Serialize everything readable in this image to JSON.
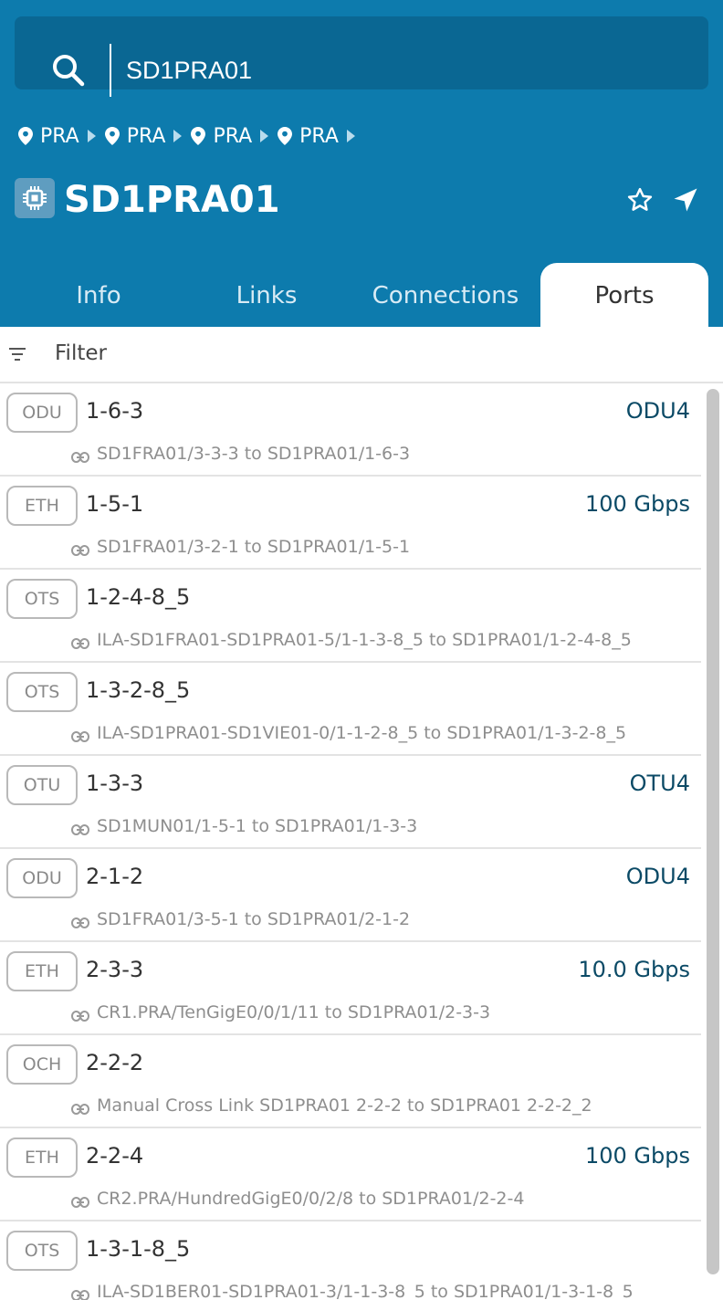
{
  "search": {
    "value": "SD1PRA01"
  },
  "breadcrumb": [
    {
      "label": "PRA"
    },
    {
      "label": "PRA"
    },
    {
      "label": "PRA"
    },
    {
      "label": "PRA"
    }
  ],
  "header": {
    "title": "SD1PRA01"
  },
  "tabs": [
    {
      "label": "Info"
    },
    {
      "label": "Links"
    },
    {
      "label": "Connections"
    },
    {
      "label": "Ports",
      "active": true
    }
  ],
  "filter": {
    "label": "Filter"
  },
  "ports": [
    {
      "type": "ODU",
      "name": "1-6-3",
      "rate": "ODU4",
      "link": "SD1FRA01/3-3-3 to SD1PRA01/1-6-3"
    },
    {
      "type": "ETH",
      "name": "1-5-1",
      "rate": "100 Gbps",
      "link": "SD1FRA01/3-2-1 to SD1PRA01/1-5-1"
    },
    {
      "type": "OTS",
      "name": "1-2-4-8_5",
      "rate": "",
      "link": "ILA-SD1FRA01-SD1PRA01-5/1-1-3-8_5 to SD1PRA01/1-2-4-8_5"
    },
    {
      "type": "OTS",
      "name": "1-3-2-8_5",
      "rate": "",
      "link": "ILA-SD1PRA01-SD1VIE01-0/1-1-2-8_5 to SD1PRA01/1-3-2-8_5"
    },
    {
      "type": "OTU",
      "name": "1-3-3",
      "rate": "OTU4",
      "link": "SD1MUN01/1-5-1 to SD1PRA01/1-3-3"
    },
    {
      "type": "ODU",
      "name": "2-1-2",
      "rate": "ODU4",
      "link": "SD1FRA01/3-5-1 to SD1PRA01/2-1-2"
    },
    {
      "type": "ETH",
      "name": "2-3-3",
      "rate": "10.0 Gbps",
      "link": "CR1.PRA/TenGigE0/0/1/11 to SD1PRA01/2-3-3"
    },
    {
      "type": "OCH",
      "name": "2-2-2",
      "rate": "",
      "link": "Manual Cross Link SD1PRA01 2-2-2 to SD1PRA01 2-2-2_2"
    },
    {
      "type": "ETH",
      "name": "2-2-4",
      "rate": "100 Gbps",
      "link": "CR2.PRA/HundredGigE0/0/2/8 to SD1PRA01/2-2-4"
    },
    {
      "type": "OTS",
      "name": "1-3-1-8_5",
      "rate": "",
      "link": "ILA-SD1BER01-SD1PRA01-3/1-1-3-8_5 to SD1PRA01/1-3-1-8_5"
    }
  ],
  "colors": {
    "header_bg": "#0d7bad",
    "search_bg": "#0a6793",
    "rate_text": "#0b4a66"
  },
  "icons": [
    "search-icon",
    "location-pin-icon",
    "chevron-right-icon",
    "device-chip-icon",
    "star-icon",
    "navigation-arrow-icon",
    "filter-icon",
    "link-icon"
  ]
}
